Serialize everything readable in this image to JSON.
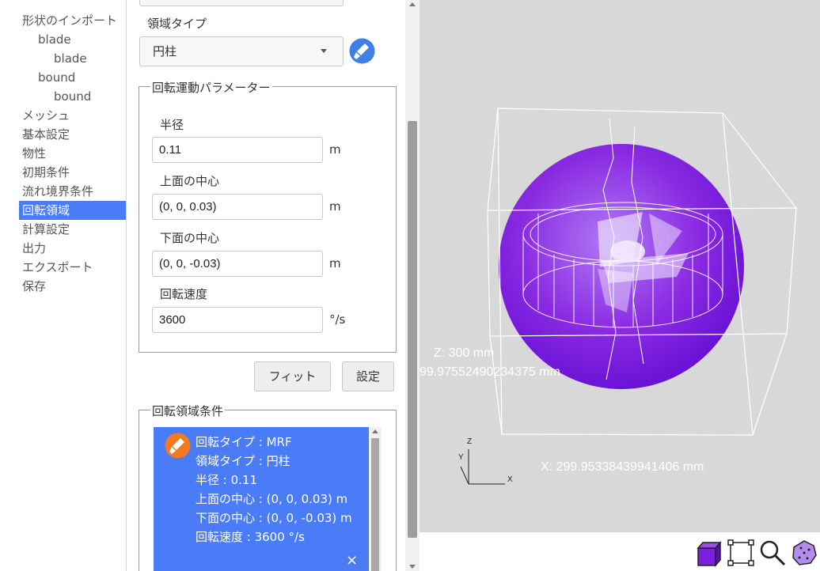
{
  "sidebar": {
    "items": [
      {
        "label": "形状のインポート"
      },
      {
        "label": "blade"
      },
      {
        "label": "blade"
      },
      {
        "label": "bound"
      },
      {
        "label": "bound"
      },
      {
        "label": "メッシュ"
      },
      {
        "label": "基本設定"
      },
      {
        "label": "物性"
      },
      {
        "label": "初期条件"
      },
      {
        "label": "流れ境界条件"
      },
      {
        "label": "回転領域"
      },
      {
        "label": "計算設定"
      },
      {
        "label": "出力"
      },
      {
        "label": "エクスポート"
      },
      {
        "label": "保存"
      }
    ],
    "active_index": 10
  },
  "panel": {
    "domain_type_label": "領域タイプ",
    "domain_type_value": "円柱",
    "rotation_group_title": "回転運動パラメーター",
    "radius_label": "半径",
    "radius_value": "0.11",
    "radius_unit": "m",
    "top_center_label": "上面の中心",
    "top_center_value": "(0, 0, 0.03)",
    "top_center_unit": "m",
    "bottom_center_label": "下面の中心",
    "bottom_center_value": "(0, 0, -0.03)",
    "bottom_center_unit": "m",
    "speed_label": "回転速度",
    "speed_value": "3600",
    "speed_unit": "°/s",
    "fit_button": "フィット",
    "set_button": "設定",
    "conditions_title": "回転領域条件",
    "condition": {
      "lines": [
        "回転タイプ : MRF",
        "領域タイプ : 円柱",
        "半径 : 0.11",
        "上面の中心 : (0, 0, 0.03) m",
        "下面の中心 : (0, 0, -0.03) m",
        "回転速度 : 3600 °/s"
      ],
      "close": "×"
    }
  },
  "viewer": {
    "z_dim": "Z: 300 mm",
    "y_dim": "99.97552490234375 mm",
    "x_dim": "X: 299.95338439941406 mm",
    "axis_z": "Z",
    "axis_y": "Y",
    "axis_x": "X",
    "background": "#d8d8d8",
    "sphere_color": "#8a2be2"
  },
  "colors": {
    "accent": "#4a7cf8",
    "tool_orange": "#f47a20",
    "tool_blue": "#3f7fe6",
    "cube": "#7b1fe0"
  }
}
